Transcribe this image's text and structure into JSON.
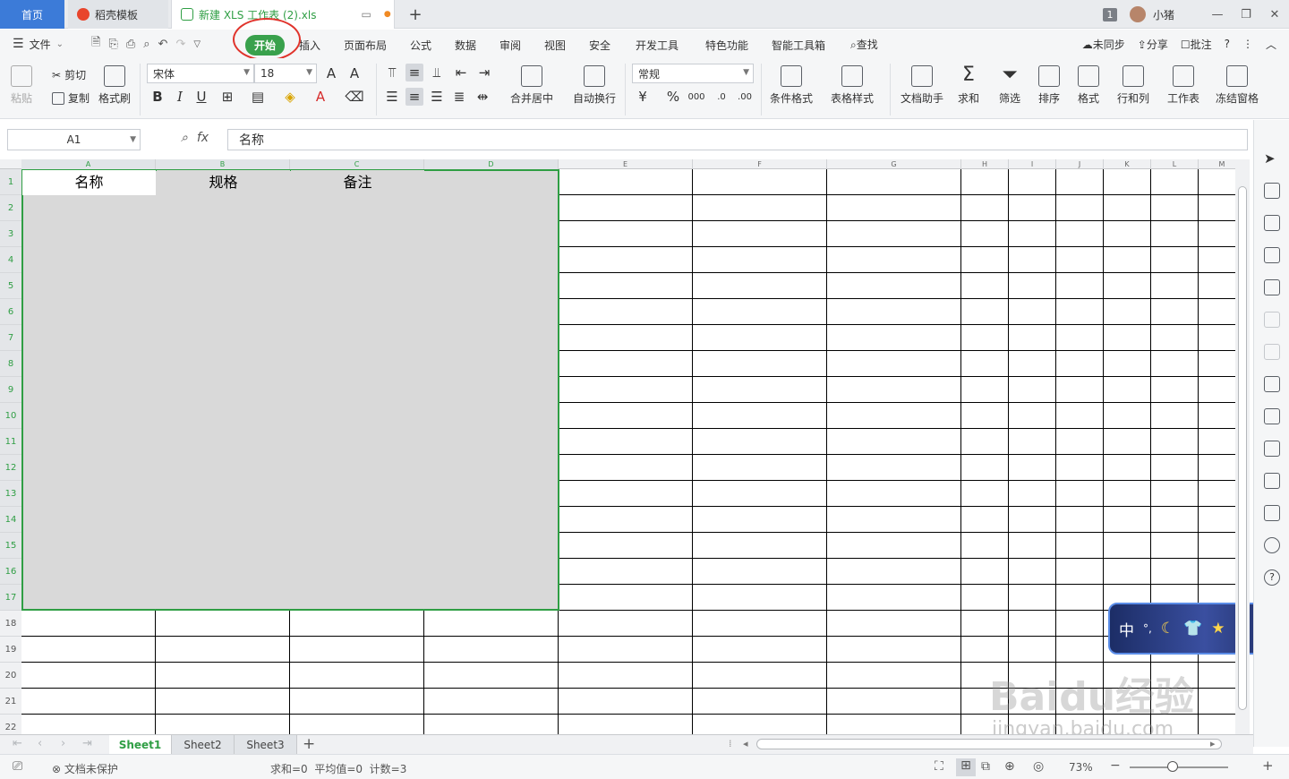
{
  "tabs": {
    "home": "首页",
    "template": "稻壳模板",
    "document": "新建 XLS 工作表 (2).xls",
    "new_tab": "+"
  },
  "titlebar": {
    "count": "1",
    "user": "小猪"
  },
  "menu": {
    "file": "文件",
    "items": [
      "开始",
      "插入",
      "页面布局",
      "公式",
      "数据",
      "审阅",
      "视图",
      "安全",
      "开发工具",
      "特色功能",
      "智能工具箱",
      "查找"
    ],
    "right": [
      "未同步",
      "分享",
      "批注"
    ]
  },
  "ribbon": {
    "paste": "粘贴",
    "cut": "剪切",
    "copy": "复制",
    "format_painter": "格式刷",
    "font": "宋体",
    "size": "18",
    "bold": "B",
    "italic": "I",
    "underline": "U",
    "merge": "合并居中",
    "wrap": "自动换行",
    "number_format": "常规",
    "percent": "%",
    "cond_format": "条件格式",
    "table_style": "表格样式",
    "doc_helper": "文档助手",
    "sum": "求和",
    "filter": "筛选",
    "sort": "排序",
    "format": "格式",
    "rowcol": "行和列",
    "worksheet": "工作表",
    "freeze": "冻结窗格"
  },
  "formula": {
    "cell": "A1",
    "fx": "fx",
    "value": "名称"
  },
  "columns": [
    "A",
    "B",
    "C",
    "D",
    "E",
    "F",
    "G",
    "H",
    "I",
    "J",
    "K",
    "L",
    "M"
  ],
  "rows": [
    "1",
    "2",
    "3",
    "4",
    "5",
    "6",
    "7",
    "8",
    "9",
    "10",
    "11",
    "12",
    "13",
    "14",
    "15",
    "16",
    "17",
    "18",
    "19",
    "20",
    "21",
    "22"
  ],
  "header_cells": [
    "名称",
    "规格",
    "备注"
  ],
  "sheets": [
    "Sheet1",
    "Sheet2",
    "Sheet3"
  ],
  "status": {
    "protect": "文档未保护",
    "stats": "求和=0  平均值=0  计数=3",
    "zoom": "73%"
  },
  "ime": {
    "label": "中"
  },
  "watermark": {
    "brand": "Baidu经验",
    "url": "jingyan.baidu.com"
  }
}
